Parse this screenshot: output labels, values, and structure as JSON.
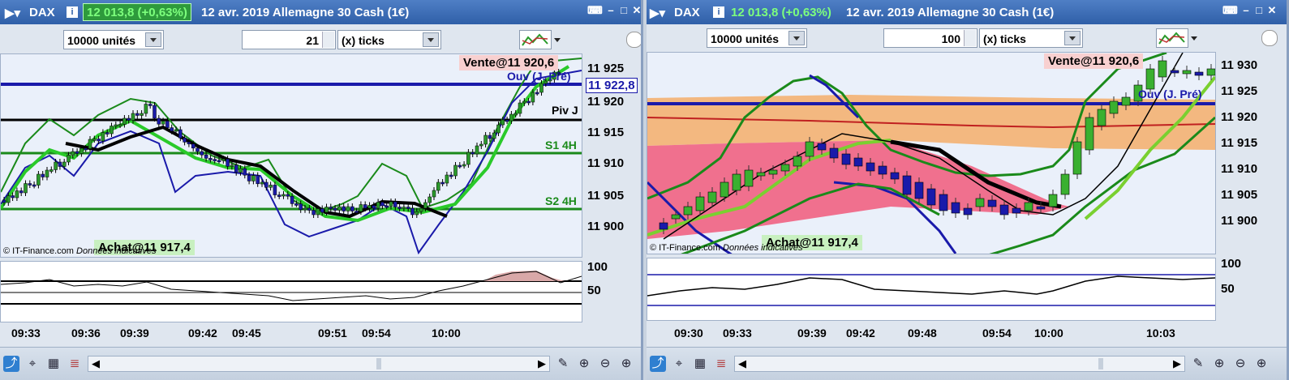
{
  "left": {
    "title": "DAX",
    "price": "12 013,8 (+0,63%)",
    "instrument": "12 avr. 2019 Allemagne 30 Cash (1€)",
    "units": "10000 unités",
    "ticks_value": "21",
    "ticks_label": "(x) ticks",
    "y_ticks": [
      "11 925",
      "11 922,8",
      "11 920",
      "11 915",
      "11 910",
      "11 905",
      "11 900"
    ],
    "osc_ticks": [
      "100",
      "50"
    ],
    "x_ticks": [
      "09:33",
      "09:36",
      "09:39",
      "09:42",
      "09:45",
      "09:51",
      "09:54",
      "10:00"
    ],
    "sell": "Vente@11 920,6",
    "buy": "Achat@11 917,4",
    "open_label": "Ouv (J. Pré)",
    "piv": "Piv J",
    "s1": "S1 4H",
    "s2": "S2 4H",
    "credit_a": "© IT-Finance.com",
    "credit_b": "Données indicatives"
  },
  "right": {
    "title": "DAX",
    "price": "12 013,8 (+0,63%)",
    "instrument": "12 avr. 2019 Allemagne 30 Cash (1€)",
    "units": "10000 unités",
    "ticks_value": "100",
    "ticks_label": "(x) ticks",
    "y_ticks": [
      "11 930",
      "11 925",
      "11 920",
      "11 915",
      "11 910",
      "11 905",
      "11 900"
    ],
    "osc_ticks": [
      "100",
      "50"
    ],
    "x_ticks": [
      "09:30",
      "09:33",
      "09:39",
      "09:42",
      "09:48",
      "09:54",
      "10:00",
      "10:03"
    ],
    "sell": "Vente@11 920,6",
    "buy": "Achat@11 917,4",
    "open_label": "Ouv (J. Pré)",
    "credit_a": "© IT-Finance.com",
    "credit_b": "Données indicatives"
  },
  "colors": {
    "title_bar": "#3a6cb8",
    "price_bg": "#2e9a3c",
    "blue_line": "#1a1aaa",
    "green_line": "#1a8a1a",
    "sell_bg": "#f8d0d0",
    "buy_bg": "#c8f0c0"
  },
  "icons": [
    "dax-menu-icon",
    "info-icon",
    "keyboard-icon",
    "minimize-icon",
    "maximize-icon",
    "close-icon",
    "indicator-icon",
    "share-icon",
    "zoom-in-icon",
    "zoom-out-icon"
  ]
}
